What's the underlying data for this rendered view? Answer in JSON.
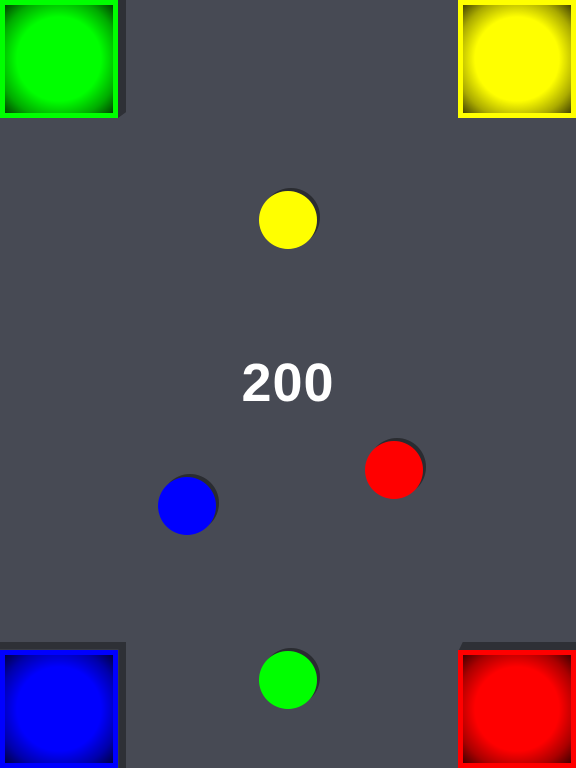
{
  "score": "200",
  "colors": {
    "background": "#474a54",
    "green": "#00ff00",
    "yellow": "#ffff00",
    "blue": "#0000ff",
    "red": "#ff0000"
  },
  "corner_boxes": [
    {
      "name": "green-corner-box",
      "color": "#00ff00",
      "position": "top-left"
    },
    {
      "name": "yellow-corner-box",
      "color": "#ffff00",
      "position": "top-right"
    },
    {
      "name": "blue-corner-box",
      "color": "#0000ff",
      "position": "bottom-left"
    },
    {
      "name": "red-corner-box",
      "color": "#ff0000",
      "position": "bottom-right"
    }
  ],
  "balls": [
    {
      "name": "yellow-ball",
      "color": "#ffff00"
    },
    {
      "name": "red-ball",
      "color": "#ff0000"
    },
    {
      "name": "blue-ball",
      "color": "#0000ff"
    },
    {
      "name": "green-ball",
      "color": "#00ff00"
    }
  ]
}
